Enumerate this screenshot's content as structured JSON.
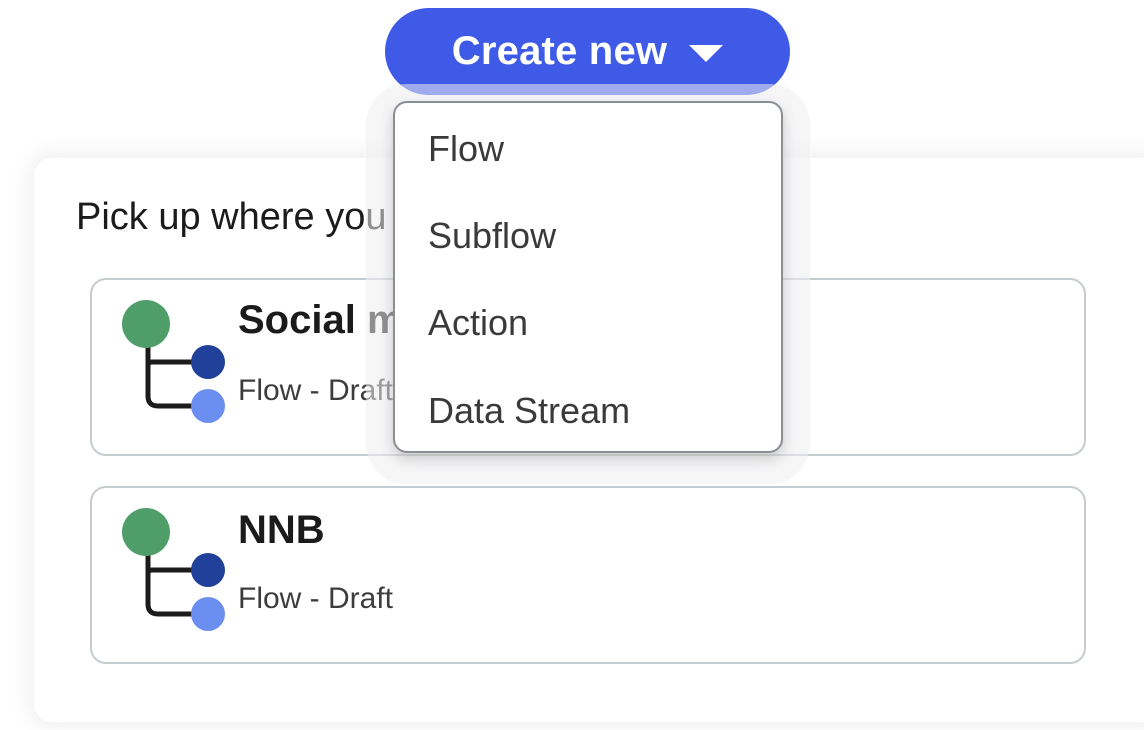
{
  "create_button": {
    "label": "Create new",
    "color": "#3e5ae6"
  },
  "dropdown": {
    "items": [
      {
        "label": "Flow"
      },
      {
        "label": "Subflow"
      },
      {
        "label": "Action"
      },
      {
        "label": "Data Stream"
      }
    ]
  },
  "recent": {
    "title": "Pick up where you left off",
    "items": [
      {
        "name": "Social media post approval",
        "meta": "Flow - Draft",
        "icon": "flow-icon"
      },
      {
        "name": "NNB",
        "meta": "Flow - Draft",
        "icon": "flow-icon"
      }
    ]
  },
  "icon_colors": {
    "root": "#4f9d69",
    "child_dark": "#21409a",
    "child_light": "#6a8ff0",
    "connector": "#1b1b1b"
  }
}
